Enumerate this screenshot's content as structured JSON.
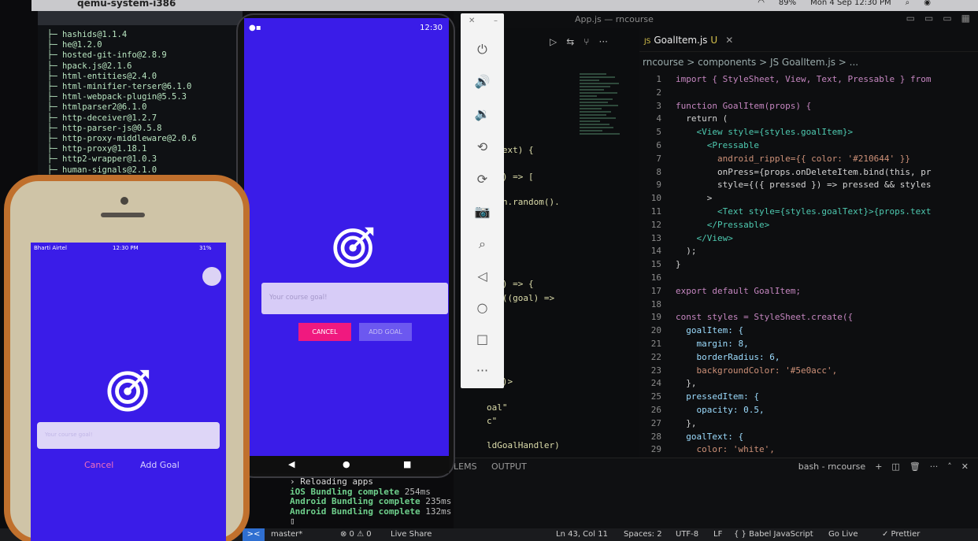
{
  "menubar": {
    "app": "qemu-system-i386",
    "battery": "89%",
    "datetime": "Mon 4 Sep  12:30 PM",
    "icons": [
      "apple-icon",
      "wifi-icon",
      "search-icon",
      "control-center-icon"
    ]
  },
  "terminal": {
    "packages": [
      "hashids@1.1.4",
      "he@1.2.0",
      "hosted-git-info@2.8.9",
      "hpack.js@2.1.6",
      "html-entities@2.4.0",
      "html-minifier-terser@6.1.0",
      "html-webpack-plugin@5.5.3",
      "htmlparser2@6.1.0",
      "http-deceiver@1.2.7",
      "http-parser-js@0.5.8",
      "http-proxy-middleware@2.0.6",
      "http-proxy@1.18.1",
      "http2-wrapper@1.0.3",
      "human-signals@2.1.0"
    ]
  },
  "vscode": {
    "window_title": "App.js — rncourse",
    "tab": {
      "label": "GoalItem.js",
      "modified": "U"
    },
    "breadcrumb": "rncourse > components > JS GoalItem.js > ...",
    "left_fragments": [
      "alText) {",
      "als) => [",
      "Math.random().",
      "als) => {",
      "ter((goal) =>",
      "ner)>",
      "oal\"",
      "c\"",
      "ldGoalHandler)"
    ],
    "code_lines": [
      {
        "n": "1",
        "t": "import { StyleSheet, View, Text, Pressable } from"
      },
      {
        "n": "2",
        "t": ""
      },
      {
        "n": "3",
        "t": "function GoalItem(props) {"
      },
      {
        "n": "4",
        "t": "  return ("
      },
      {
        "n": "5",
        "t": "    <View style={styles.goalItem}>"
      },
      {
        "n": "6",
        "t": "      <Pressable"
      },
      {
        "n": "7",
        "t": "        android_ripple={{ color: '#210644' }}"
      },
      {
        "n": "8",
        "t": "        onPress={props.onDeleteItem.bind(this, pr"
      },
      {
        "n": "9",
        "t": "        style={({ pressed }) => pressed && styles"
      },
      {
        "n": "10",
        "t": "      >"
      },
      {
        "n": "11",
        "t": "        <Text style={styles.goalText}>{props.text"
      },
      {
        "n": "12",
        "t": "      </Pressable>"
      },
      {
        "n": "13",
        "t": "    </View>"
      },
      {
        "n": "14",
        "t": "  );"
      },
      {
        "n": "15",
        "t": "}"
      },
      {
        "n": "16",
        "t": ""
      },
      {
        "n": "17",
        "t": "export default GoalItem;"
      },
      {
        "n": "18",
        "t": ""
      },
      {
        "n": "19",
        "t": "const styles = StyleSheet.create({"
      },
      {
        "n": "20",
        "t": "  goalItem: {"
      },
      {
        "n": "21",
        "t": "    margin: 8,"
      },
      {
        "n": "22",
        "t": "    borderRadius: 6,"
      },
      {
        "n": "23",
        "t": "    backgroundColor: '#5e0acc',"
      },
      {
        "n": "24",
        "t": "  },"
      },
      {
        "n": "25",
        "t": "  pressedItem: {"
      },
      {
        "n": "26",
        "t": "    opacity: 0.5,"
      },
      {
        "n": "27",
        "t": "  },"
      },
      {
        "n": "28",
        "t": "  goalText: {"
      },
      {
        "n": "29",
        "t": "    color: 'white',"
      }
    ],
    "panel_tabs": [
      "LEMS",
      "OUTPUT"
    ],
    "terminal_name": "bash - rncourse",
    "terminal_output": [
      {
        "prefix": "",
        "text": "› Reloading apps",
        "suffix": ""
      },
      {
        "prefix": "iOS",
        "text": " Bundling complete ",
        "suffix": "254ms"
      },
      {
        "prefix": "Android",
        "text": " Bundling complete ",
        "suffix": "235ms"
      },
      {
        "prefix": "Android",
        "text": " Bundling complete ",
        "suffix": "132ms"
      }
    ],
    "status": {
      "branch": "master*",
      "problems": "⊗ 0 ⚠ 0",
      "liveshare": "Live Share",
      "position": "Ln 43, Col 11",
      "spaces": "Spaces: 2",
      "encoding": "UTF-8",
      "eol": "LF",
      "language": "{ } Babel JavaScript",
      "golive": "Go Live",
      "prettier": "✓ Prettier"
    }
  },
  "android": {
    "status_time": "12:30",
    "input_placeholder": "Your course goal!",
    "cancel_label": "CANCEL",
    "add_label": "ADD GOAL",
    "colors": {
      "screen": "#3a1ce8",
      "cancel": "#f0197f",
      "add": "#6c58f0"
    }
  },
  "iphone": {
    "carrier": "Bharti Airtel",
    "time": "12:30 PM",
    "battery": "31%",
    "input_placeholder": "Your course goal!",
    "cancel_label": "Cancel",
    "add_label": "Add Goal"
  }
}
